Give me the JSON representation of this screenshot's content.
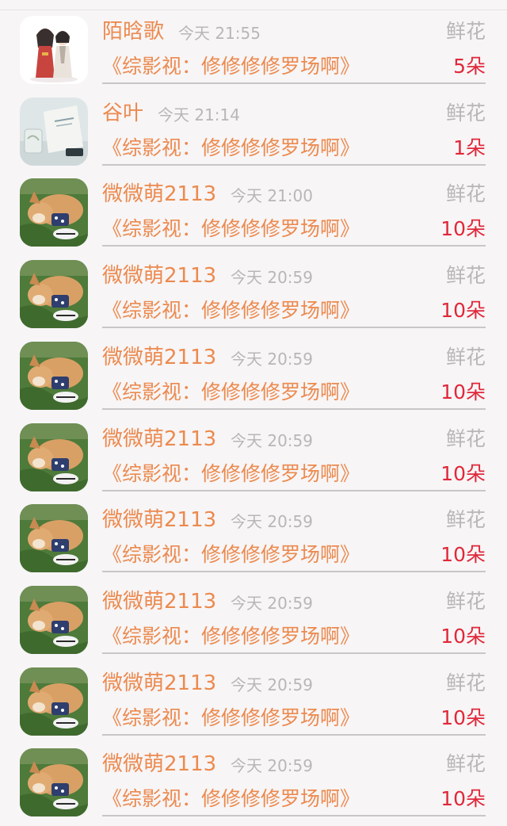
{
  "list": {
    "items": [
      {
        "user": "陌晗歌",
        "time": "今天 21:55",
        "gift_type": "鲜花",
        "book": "《综影视：修修修修罗场啊》",
        "count": "5朵",
        "avatar": "couple-illustration-avatar"
      },
      {
        "user": "谷叶",
        "time": "今天 21:14",
        "gift_type": "鲜花",
        "book": "《综影视：修修修修罗场啊》",
        "count": "1朵",
        "avatar": "bag-photo-avatar"
      },
      {
        "user": "微微萌2113",
        "time": "今天 21:00",
        "gift_type": "鲜花",
        "book": "《综影视：修修修修罗场啊》",
        "count": "10朵",
        "avatar": "corgi-photo-avatar"
      },
      {
        "user": "微微萌2113",
        "time": "今天 20:59",
        "gift_type": "鲜花",
        "book": "《综影视：修修修修罗场啊》",
        "count": "10朵",
        "avatar": "corgi-photo-avatar"
      },
      {
        "user": "微微萌2113",
        "time": "今天 20:59",
        "gift_type": "鲜花",
        "book": "《综影视：修修修修罗场啊》",
        "count": "10朵",
        "avatar": "corgi-photo-avatar"
      },
      {
        "user": "微微萌2113",
        "time": "今天 20:59",
        "gift_type": "鲜花",
        "book": "《综影视：修修修修罗场啊》",
        "count": "10朵",
        "avatar": "corgi-photo-avatar"
      },
      {
        "user": "微微萌2113",
        "time": "今天 20:59",
        "gift_type": "鲜花",
        "book": "《综影视：修修修修罗场啊》",
        "count": "10朵",
        "avatar": "corgi-photo-avatar"
      },
      {
        "user": "微微萌2113",
        "time": "今天 20:59",
        "gift_type": "鲜花",
        "book": "《综影视：修修修修罗场啊》",
        "count": "10朵",
        "avatar": "corgi-photo-avatar"
      },
      {
        "user": "微微萌2113",
        "time": "今天 20:59",
        "gift_type": "鲜花",
        "book": "《综影视：修修修修罗场啊》",
        "count": "10朵",
        "avatar": "corgi-photo-avatar"
      },
      {
        "user": "微微萌2113",
        "time": "今天 20:59",
        "gift_type": "鲜花",
        "book": "《综影视：修修修修罗场啊》",
        "count": "10朵",
        "avatar": "corgi-photo-avatar"
      }
    ]
  },
  "colors": {
    "background": "#f7f5f6",
    "username": "#ec8a4f",
    "book_title": "#ec8a4f",
    "secondary_text": "#b9b6b7",
    "count": "#e0283a"
  }
}
